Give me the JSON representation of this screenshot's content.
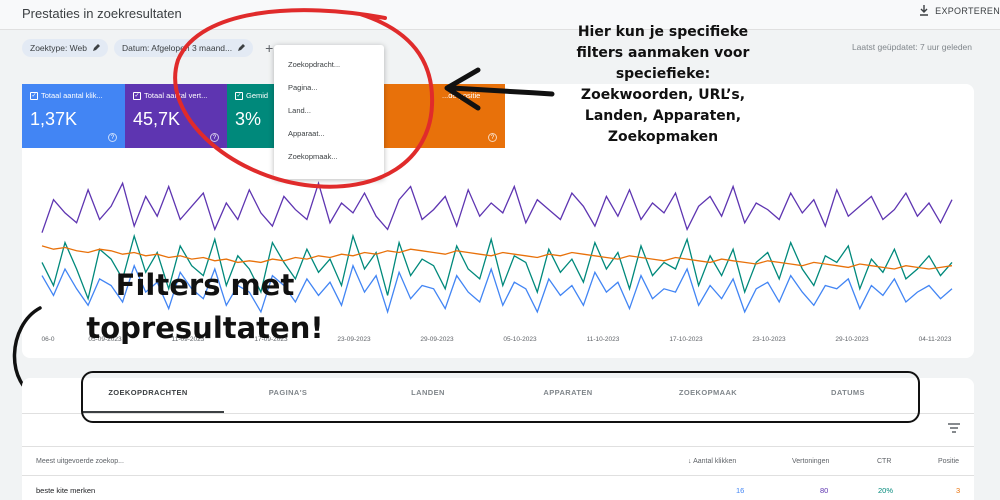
{
  "header": {
    "title": "Prestaties in zoekresultaten",
    "export_label": "EXPORTEREN",
    "updated": "Laatst geüpdatet: 7 uur geleden"
  },
  "filters": {
    "chips": [
      {
        "label": "Zoektype: Web"
      },
      {
        "label": "Datum: Afgelopen 3 maand..."
      }
    ],
    "add_symbol": "+"
  },
  "dropdown": {
    "items": [
      "Zoekopdracht...",
      "Pagina...",
      "Land...",
      "Apparaat...",
      "Zoekopmaak..."
    ]
  },
  "metrics": [
    {
      "label": "Totaal aantal klik...",
      "value": "1,37K",
      "color": "#4285f4"
    },
    {
      "label": "Totaal aantal vert...",
      "value": "45,7K",
      "color": "#5e35b1"
    },
    {
      "label": "Gemid",
      "value": "3%",
      "color": "#00897b"
    },
    {
      "label": "...de positie",
      "value": "",
      "color": "#e8710a"
    }
  ],
  "chart_data": {
    "type": "line",
    "x": [
      "06-0",
      "05-09-2023",
      "11-09-2023",
      "17-09-2023",
      "23-09-2023",
      "29-09-2023",
      "05-10-2023",
      "11-10-2023",
      "17-10-2023",
      "23-10-2023",
      "29-10-2023",
      "04-11-2023"
    ],
    "series": [
      {
        "color": "#5e35b1",
        "values": [
          62,
          82,
          74,
          68,
          88,
          70,
          78,
          92,
          66,
          84,
          72,
          90,
          70,
          78,
          86,
          64,
          80,
          70,
          88,
          74,
          66,
          84,
          76,
          70,
          92,
          68,
          80,
          74,
          86,
          72,
          64,
          82,
          90,
          70,
          76,
          84,
          66,
          88,
          72,
          80,
          74,
          90,
          68,
          82,
          76,
          70,
          86,
          78,
          66,
          84,
          72,
          88,
          70,
          80,
          74,
          86,
          64,
          78,
          84,
          72,
          90,
          68,
          80,
          76,
          70,
          86,
          74,
          82,
          66,
          88,
          72,
          78,
          84,
          70,
          76,
          86,
          72,
          80,
          68,
          82
        ]
      },
      {
        "color": "#00897b",
        "values": [
          44,
          30,
          56,
          40,
          22,
          52,
          46,
          34,
          60,
          38,
          50,
          28,
          54,
          42,
          36,
          58,
          30,
          48,
          40,
          26,
          56,
          44,
          34,
          52,
          38,
          46,
          30,
          60,
          40,
          50,
          24,
          56,
          36,
          46,
          42,
          28,
          54,
          40,
          34,
          58,
          30,
          48,
          44,
          26,
          52,
          38,
          46,
          32,
          56,
          40,
          50,
          28,
          54,
          36,
          44,
          40,
          58,
          30,
          48,
          36,
          52,
          26,
          44,
          50,
          34,
          56,
          40,
          30,
          48,
          44,
          54,
          28,
          46,
          38,
          52,
          34,
          40,
          48,
          36,
          44
        ]
      },
      {
        "color": "#e8710a",
        "values": [
          54,
          52,
          53,
          51,
          50,
          52,
          51,
          49,
          50,
          48,
          49,
          47,
          48,
          46,
          47,
          45,
          46,
          44,
          45,
          44,
          46,
          45,
          47,
          46,
          48,
          47,
          49,
          48,
          50,
          49,
          51,
          50,
          52,
          51,
          50,
          49,
          51,
          50,
          49,
          48,
          50,
          49,
          48,
          47,
          49,
          48,
          50,
          49,
          48,
          47,
          46,
          48,
          47,
          46,
          45,
          47,
          46,
          45,
          44,
          46,
          45,
          44,
          43,
          45,
          44,
          43,
          42,
          44,
          43,
          42,
          41,
          43,
          42,
          41,
          40,
          42,
          41,
          40,
          41,
          42
        ]
      },
      {
        "color": "#4285f4",
        "values": [
          36,
          24,
          40,
          28,
          18,
          34,
          30,
          20,
          42,
          26,
          32,
          16,
          38,
          28,
          22,
          40,
          18,
          30,
          26,
          14,
          36,
          30,
          20,
          34,
          24,
          32,
          18,
          42,
          26,
          36,
          14,
          38,
          22,
          30,
          28,
          16,
          36,
          26,
          20,
          40,
          18,
          32,
          28,
          14,
          34,
          24,
          30,
          18,
          38,
          26,
          32,
          16,
          36,
          22,
          28,
          26,
          40,
          18,
          30,
          22,
          34,
          14,
          28,
          32,
          20,
          36,
          26,
          18,
          30,
          28,
          34,
          16,
          30,
          24,
          34,
          20,
          26,
          30,
          22,
          28
        ]
      }
    ],
    "ylim": [
      0,
      100
    ]
  },
  "annotations": {
    "right_text": [
      "Hier kun je specifieke",
      "filters aanmaken voor",
      "speciefieke:",
      "Zoekwoorden, URL’s,",
      "Landen, Apparaten,",
      "Zoekopmaken"
    ],
    "big_text": [
      "Filters met",
      "topresultaten!"
    ]
  },
  "tabs": [
    "ZOEKOPDRACHTEN",
    "PAGINA'S",
    "LANDEN",
    "APPARATEN",
    "ZOEKOPMAAK",
    "DATUMS"
  ],
  "table": {
    "columns": [
      "Meest uitgevoerde zoekop...",
      "Aantal klikken",
      "Vertoningen",
      "CTR",
      "Positie"
    ],
    "rows": [
      {
        "query": "beste kite merken",
        "clicks": "16",
        "impressions": "80",
        "ctr": "20%",
        "position": "3"
      }
    ]
  }
}
